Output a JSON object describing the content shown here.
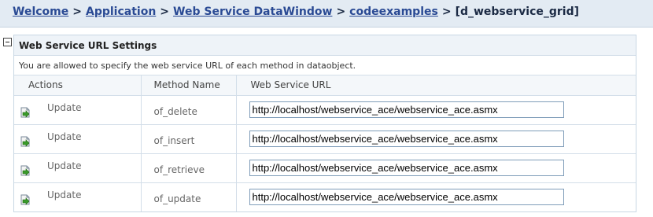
{
  "breadcrumb": {
    "items": [
      "Welcome",
      "Application",
      "Web Service DataWindow",
      "codeexamples"
    ],
    "separator": ">",
    "current": "[d_webservice_grid]"
  },
  "panel": {
    "title": "Web Service URL Settings",
    "description": "You are allowed to specify the web service URL of each method in dataobject.",
    "columns": {
      "actions": "Actions",
      "method": "Method Name",
      "url": "Web Service URL"
    },
    "rows": [
      {
        "action": "Update",
        "method": "of_delete",
        "url": "http://localhost/webservice_ace/webservice_ace.asmx"
      },
      {
        "action": "Update",
        "method": "of_insert",
        "url": "http://localhost/webservice_ace/webservice_ace.asmx"
      },
      {
        "action": "Update",
        "method": "of_retrieve",
        "url": "http://localhost/webservice_ace/webservice_ace.asmx"
      },
      {
        "action": "Update",
        "method": "of_update",
        "url": "http://localhost/webservice_ace/webservice_ace.asmx"
      }
    ]
  },
  "colors": {
    "link": "#2a4a94",
    "breadcrumb_bg": "#e3ebf3",
    "border": "#c9d7e4",
    "icon_green": "#3a9a2a"
  },
  "icons": {
    "collapse": "minus-box-icon",
    "update": "update-arrow-icon"
  }
}
